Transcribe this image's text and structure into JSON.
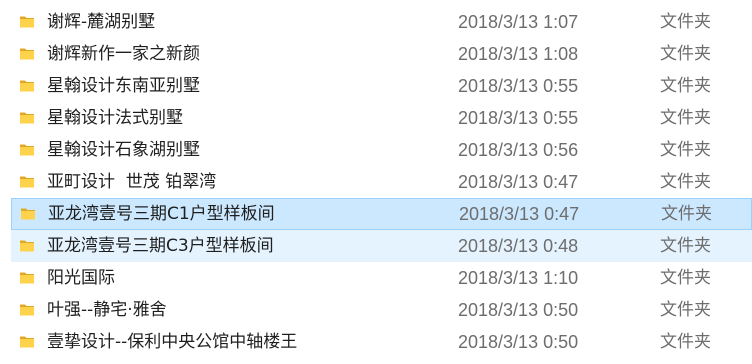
{
  "files": [
    {
      "name": "谢辉-麓湖别墅",
      "date": "2018/3/13 1:07",
      "type": "文件夹",
      "icon": "folder-icon",
      "state": "normal"
    },
    {
      "name": "谢辉新作一家之新颜",
      "date": "2018/3/13 1:08",
      "type": "文件夹",
      "icon": "folder-icon",
      "state": "normal"
    },
    {
      "name": "星翰设计东南亚别墅",
      "date": "2018/3/13 0:55",
      "type": "文件夹",
      "icon": "folder-icon",
      "state": "normal"
    },
    {
      "name": "星翰设计法式别墅",
      "date": "2018/3/13 0:55",
      "type": "文件夹",
      "icon": "folder-icon",
      "state": "normal"
    },
    {
      "name": "星翰设计石象湖别墅",
      "date": "2018/3/13 0:56",
      "type": "文件夹",
      "icon": "folder-icon",
      "state": "normal"
    },
    {
      "name": "亚町设计  世茂 铂翠湾",
      "date": "2018/3/13 0:47",
      "type": "文件夹",
      "icon": "folder-icon",
      "state": "normal"
    },
    {
      "name": "亚龙湾壹号三期C1户型样板间",
      "date": "2018/3/13 0:47",
      "type": "文件夹",
      "icon": "folder-icon",
      "state": "selected"
    },
    {
      "name": "亚龙湾壹号三期C3户型样板间",
      "date": "2018/3/13 0:48",
      "type": "文件夹",
      "icon": "folder-icon",
      "state": "hover"
    },
    {
      "name": "阳光国际",
      "date": "2018/3/13 1:10",
      "type": "文件夹",
      "icon": "folder-icon",
      "state": "normal"
    },
    {
      "name": "叶强--静宅·雅舍",
      "date": "2018/3/13 0:50",
      "type": "文件夹",
      "icon": "folder-icon",
      "state": "normal"
    },
    {
      "name": "壹挚设计--保利中央公馆中轴楼王",
      "date": "2018/3/13 0:50",
      "type": "文件夹",
      "icon": "folder-icon",
      "state": "normal"
    }
  ],
  "colors": {
    "selected_bg": "#cce8ff",
    "selected_border": "#99d1ff",
    "hover_bg": "#e5f3ff",
    "folder_yellow": "#ffd24c",
    "folder_dark": "#e0a924"
  }
}
